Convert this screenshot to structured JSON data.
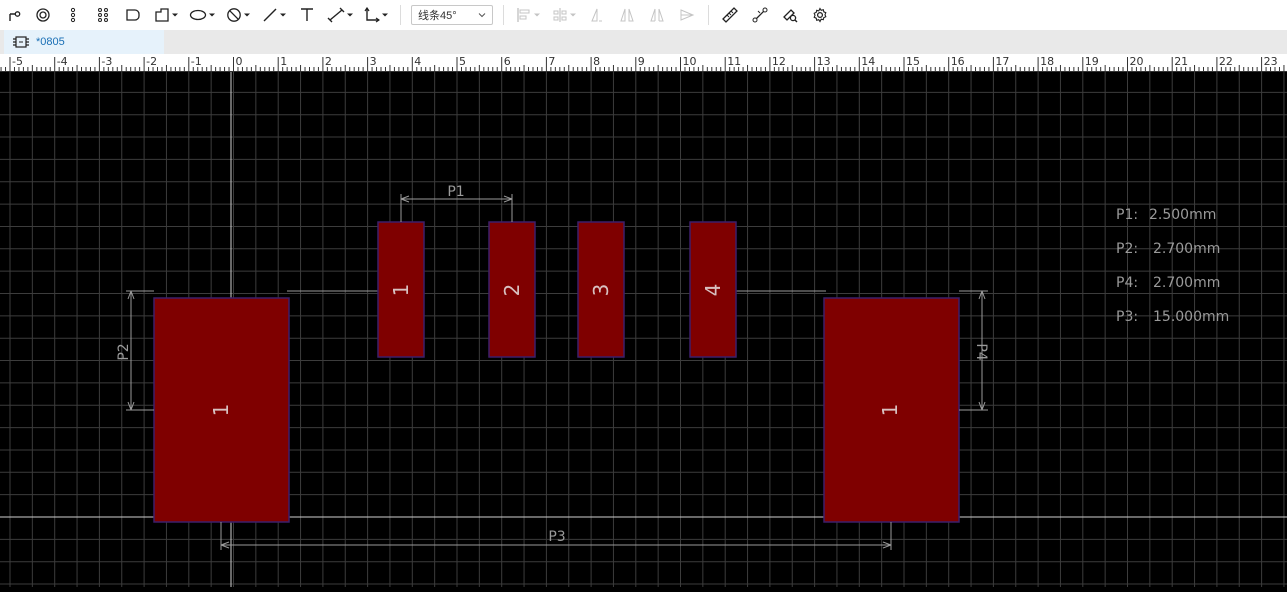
{
  "toolbar": {
    "line_mode": "线条45°",
    "tools": [
      {
        "name": "wire-tool-icon"
      },
      {
        "name": "pad-tool-icon"
      },
      {
        "name": "pad-row-tool-icon"
      },
      {
        "name": "pad-grid-tool-icon"
      },
      {
        "name": "rounded-rect-tool-icon"
      },
      {
        "name": "polygon-tool-icon",
        "dropdown": true
      },
      {
        "name": "ellipse-tool-icon",
        "dropdown": true
      },
      {
        "name": "circle-tool-icon",
        "dropdown": true
      },
      {
        "name": "line-tool-icon",
        "dropdown": true
      },
      {
        "name": "text-tool-icon"
      },
      {
        "name": "dimension-tool-icon",
        "dropdown": true
      },
      {
        "name": "axis-tool-icon",
        "dropdown": true
      }
    ]
  },
  "tab": {
    "label": "*0805"
  },
  "ruler": {
    "labels": [
      "-5",
      "-4",
      "-3",
      "-2",
      "-1",
      "0",
      "1",
      "2",
      "3",
      "4",
      "5",
      "6",
      "7",
      "8",
      "9",
      "10",
      "11",
      "12",
      "13",
      "14",
      "15",
      "16",
      "17",
      "18",
      "19",
      "20",
      "21",
      "22",
      "23"
    ]
  },
  "pads": {
    "small": [
      {
        "label": "1"
      },
      {
        "label": "2"
      },
      {
        "label": "3"
      },
      {
        "label": "4"
      }
    ],
    "large": [
      {
        "label": "1"
      },
      {
        "label": "1"
      }
    ]
  },
  "dimensions": {
    "p1": "P1",
    "p2": "P2",
    "p3": "P3",
    "p4": "P4"
  },
  "params": [
    {
      "label": "P1:",
      "value": "2.500mm"
    },
    {
      "label": "P2:",
      "value": "2.700mm"
    },
    {
      "label": "P4:",
      "value": "2.700mm"
    },
    {
      "label": "P3:",
      "value": "15.000mm"
    }
  ],
  "colors": {
    "background": "#000000",
    "grid": "#3c3c3c",
    "pad_fill": "#7f0000",
    "pad_stroke": "#3d1f6b",
    "pad_text": "#d8c0c0",
    "dimension": "#9a9a9a",
    "axis": "#cfcfcf"
  }
}
